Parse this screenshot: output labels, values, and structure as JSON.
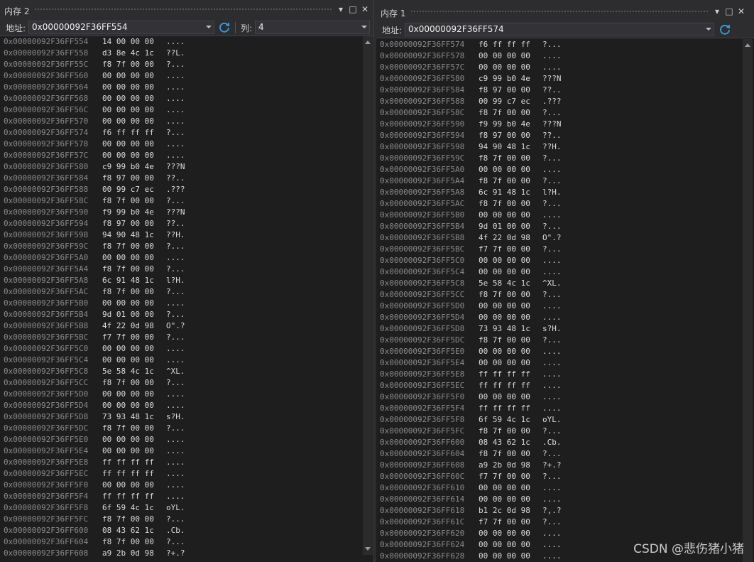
{
  "left_panel": {
    "title": "内存 2",
    "address_label": "地址:",
    "address_value": "0x00000092F36FF554",
    "column_label": "列:",
    "column_value": "4",
    "rows": [
      [
        "0x00000092F36FF554",
        "14 00 00 00",
        "...."
      ],
      [
        "0x00000092F36FF558",
        "d3 8e 4c 1c",
        "??L."
      ],
      [
        "0x00000092F36FF55C",
        "f8 7f 00 00",
        "?..."
      ],
      [
        "0x00000092F36FF560",
        "00 00 00 00",
        "...."
      ],
      [
        "0x00000092F36FF564",
        "00 00 00 00",
        "...."
      ],
      [
        "0x00000092F36FF568",
        "00 00 00 00",
        "...."
      ],
      [
        "0x00000092F36FF56C",
        "00 00 00 00",
        "...."
      ],
      [
        "0x00000092F36FF570",
        "00 00 00 00",
        "...."
      ],
      [
        "0x00000092F36FF574",
        "f6 ff ff ff",
        "?..."
      ],
      [
        "0x00000092F36FF578",
        "00 00 00 00",
        "...."
      ],
      [
        "0x00000092F36FF57C",
        "00 00 00 00",
        "...."
      ],
      [
        "0x00000092F36FF580",
        "c9 99 b0 4e",
        "???N"
      ],
      [
        "0x00000092F36FF584",
        "f8 97 00 00",
        "??.."
      ],
      [
        "0x00000092F36FF588",
        "00 99 c7 ec",
        ".???"
      ],
      [
        "0x00000092F36FF58C",
        "f8 7f 00 00",
        "?..."
      ],
      [
        "0x00000092F36FF590",
        "f9 99 b0 4e",
        "???N"
      ],
      [
        "0x00000092F36FF594",
        "f8 97 00 00",
        "??.."
      ],
      [
        "0x00000092F36FF598",
        "94 90 48 1c",
        "??H."
      ],
      [
        "0x00000092F36FF59C",
        "f8 7f 00 00",
        "?..."
      ],
      [
        "0x00000092F36FF5A0",
        "00 00 00 00",
        "...."
      ],
      [
        "0x00000092F36FF5A4",
        "f8 7f 00 00",
        "?..."
      ],
      [
        "0x00000092F36FF5A8",
        "6c 91 48 1c",
        "l?H."
      ],
      [
        "0x00000092F36FF5AC",
        "f8 7f 00 00",
        "?..."
      ],
      [
        "0x00000092F36FF5B0",
        "00 00 00 00",
        "...."
      ],
      [
        "0x00000092F36FF5B4",
        "9d 01 00 00",
        "?..."
      ],
      [
        "0x00000092F36FF5B8",
        "4f 22 0d 98",
        "O\".?"
      ],
      [
        "0x00000092F36FF5BC",
        "f7 7f 00 00",
        "?..."
      ],
      [
        "0x00000092F36FF5C0",
        "00 00 00 00",
        "...."
      ],
      [
        "0x00000092F36FF5C4",
        "00 00 00 00",
        "...."
      ],
      [
        "0x00000092F36FF5C8",
        "5e 58 4c 1c",
        "^XL."
      ],
      [
        "0x00000092F36FF5CC",
        "f8 7f 00 00",
        "?..."
      ],
      [
        "0x00000092F36FF5D0",
        "00 00 00 00",
        "...."
      ],
      [
        "0x00000092F36FF5D4",
        "00 00 00 00",
        "...."
      ],
      [
        "0x00000092F36FF5D8",
        "73 93 48 1c",
        "s?H."
      ],
      [
        "0x00000092F36FF5DC",
        "f8 7f 00 00",
        "?..."
      ],
      [
        "0x00000092F36FF5E0",
        "00 00 00 00",
        "...."
      ],
      [
        "0x00000092F36FF5E4",
        "00 00 00 00",
        "...."
      ],
      [
        "0x00000092F36FF5E8",
        "ff ff ff ff",
        "...."
      ],
      [
        "0x00000092F36FF5EC",
        "ff ff ff ff",
        "...."
      ],
      [
        "0x00000092F36FF5F0",
        "00 00 00 00",
        "...."
      ],
      [
        "0x00000092F36FF5F4",
        "ff ff ff ff",
        "...."
      ],
      [
        "0x00000092F36FF5F8",
        "6f 59 4c 1c",
        "oYL."
      ],
      [
        "0x00000092F36FF5FC",
        "f8 7f 00 00",
        "?..."
      ],
      [
        "0x00000092F36FF600",
        "08 43 62 1c",
        ".Cb."
      ],
      [
        "0x00000092F36FF604",
        "f8 7f 00 00",
        "?..."
      ],
      [
        "0x00000092F36FF608",
        "a9 2b 0d 98",
        "?+.?"
      ]
    ]
  },
  "right_panel": {
    "title": "内存 1",
    "address_label": "地址:",
    "address_value": "0x00000092F36FF574",
    "rows": [
      [
        "0x00000092F36FF574",
        "f6 ff ff ff",
        "?..."
      ],
      [
        "0x00000092F36FF578",
        "00 00 00 00",
        "...."
      ],
      [
        "0x00000092F36FF57C",
        "00 00 00 00",
        "...."
      ],
      [
        "0x00000092F36FF580",
        "c9 99 b0 4e",
        "???N"
      ],
      [
        "0x00000092F36FF584",
        "f8 97 00 00",
        "??.."
      ],
      [
        "0x00000092F36FF588",
        "00 99 c7 ec",
        ".???"
      ],
      [
        "0x00000092F36FF58C",
        "f8 7f 00 00",
        "?..."
      ],
      [
        "0x00000092F36FF590",
        "f9 99 b0 4e",
        "???N"
      ],
      [
        "0x00000092F36FF594",
        "f8 97 00 00",
        "??.."
      ],
      [
        "0x00000092F36FF598",
        "94 90 48 1c",
        "??H."
      ],
      [
        "0x00000092F36FF59C",
        "f8 7f 00 00",
        "?..."
      ],
      [
        "0x00000092F36FF5A0",
        "00 00 00 00",
        "...."
      ],
      [
        "0x00000092F36FF5A4",
        "f8 7f 00 00",
        "?..."
      ],
      [
        "0x00000092F36FF5A8",
        "6c 91 48 1c",
        "l?H."
      ],
      [
        "0x00000092F36FF5AC",
        "f8 7f 00 00",
        "?..."
      ],
      [
        "0x00000092F36FF5B0",
        "00 00 00 00",
        "...."
      ],
      [
        "0x00000092F36FF5B4",
        "9d 01 00 00",
        "?..."
      ],
      [
        "0x00000092F36FF5B8",
        "4f 22 0d 98",
        "O\".?"
      ],
      [
        "0x00000092F36FF5BC",
        "f7 7f 00 00",
        "?..."
      ],
      [
        "0x00000092F36FF5C0",
        "00 00 00 00",
        "...."
      ],
      [
        "0x00000092F36FF5C4",
        "00 00 00 00",
        "...."
      ],
      [
        "0x00000092F36FF5C8",
        "5e 58 4c 1c",
        "^XL."
      ],
      [
        "0x00000092F36FF5CC",
        "f8 7f 00 00",
        "?..."
      ],
      [
        "0x00000092F36FF5D0",
        "00 00 00 00",
        "...."
      ],
      [
        "0x00000092F36FF5D4",
        "00 00 00 00",
        "...."
      ],
      [
        "0x00000092F36FF5D8",
        "73 93 48 1c",
        "s?H."
      ],
      [
        "0x00000092F36FF5DC",
        "f8 7f 00 00",
        "?..."
      ],
      [
        "0x00000092F36FF5E0",
        "00 00 00 00",
        "...."
      ],
      [
        "0x00000092F36FF5E4",
        "00 00 00 00",
        "...."
      ],
      [
        "0x00000092F36FF5E8",
        "ff ff ff ff",
        "...."
      ],
      [
        "0x00000092F36FF5EC",
        "ff ff ff ff",
        "...."
      ],
      [
        "0x00000092F36FF5F0",
        "00 00 00 00",
        "...."
      ],
      [
        "0x00000092F36FF5F4",
        "ff ff ff ff",
        "...."
      ],
      [
        "0x00000092F36FF5F8",
        "6f 59 4c 1c",
        "oYL."
      ],
      [
        "0x00000092F36FF5FC",
        "f8 7f 00 00",
        "?..."
      ],
      [
        "0x00000092F36FF600",
        "08 43 62 1c",
        ".Cb."
      ],
      [
        "0x00000092F36FF604",
        "f8 7f 00 00",
        "?..."
      ],
      [
        "0x00000092F36FF608",
        "a9 2b 0d 98",
        "?+.?"
      ],
      [
        "0x00000092F36FF60C",
        "f7 7f 00 00",
        "?..."
      ],
      [
        "0x00000092F36FF610",
        "00 00 00 00",
        "...."
      ],
      [
        "0x00000092F36FF614",
        "00 00 00 00",
        "...."
      ],
      [
        "0x00000092F36FF618",
        "b1 2c 0d 98",
        "?,.?"
      ],
      [
        "0x00000092F36FF61C",
        "f7 7f 00 00",
        "?..."
      ],
      [
        "0x00000092F36FF620",
        "00 00 00 00",
        "...."
      ],
      [
        "0x00000092F36FF624",
        "00 00 00 00",
        "...."
      ],
      [
        "0x00000092F36FF628",
        "00 00 00 00",
        "...."
      ]
    ]
  },
  "window_buttons": {
    "dropdown": "▾",
    "maximize": "□",
    "close": "✕"
  },
  "watermark": "CSDN @悲伤猪小猪",
  "colors": {
    "background": "#1e1e1e",
    "chrome": "#2d2d30",
    "address_text": "#8a8a8a",
    "refresh_icon": "#3c9de2"
  }
}
